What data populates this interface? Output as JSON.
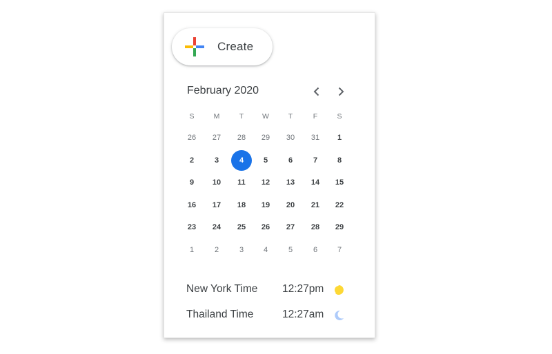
{
  "create_button": {
    "label": "Create"
  },
  "calendar": {
    "month_title": "February 2020",
    "weekdays": [
      "S",
      "M",
      "T",
      "W",
      "T",
      "F",
      "S"
    ],
    "weeks": [
      [
        "26",
        "27",
        "28",
        "29",
        "30",
        "31",
        "1"
      ],
      [
        "2",
        "3",
        "4",
        "5",
        "6",
        "7",
        "8"
      ],
      [
        "9",
        "10",
        "11",
        "12",
        "13",
        "14",
        "15"
      ],
      [
        "16",
        "17",
        "18",
        "19",
        "20",
        "21",
        "22"
      ],
      [
        "23",
        "24",
        "25",
        "26",
        "27",
        "28",
        "29"
      ],
      [
        "1",
        "2",
        "3",
        "4",
        "5",
        "6",
        "7"
      ]
    ],
    "selected": "4"
  },
  "timezones": [
    {
      "name": "New York Time",
      "time": "12:27pm",
      "icon": "sun-icon"
    },
    {
      "name": "Thailand Time",
      "time": "12:27am",
      "icon": "moon-icon"
    }
  ],
  "colors": {
    "accent": "#1a73e8",
    "plus_red": "#ea4335",
    "plus_blue": "#4285f4",
    "plus_green": "#34a853",
    "plus_yellow": "#fbbc04",
    "sun": "#fdd835",
    "moon": "#aecbfa"
  }
}
